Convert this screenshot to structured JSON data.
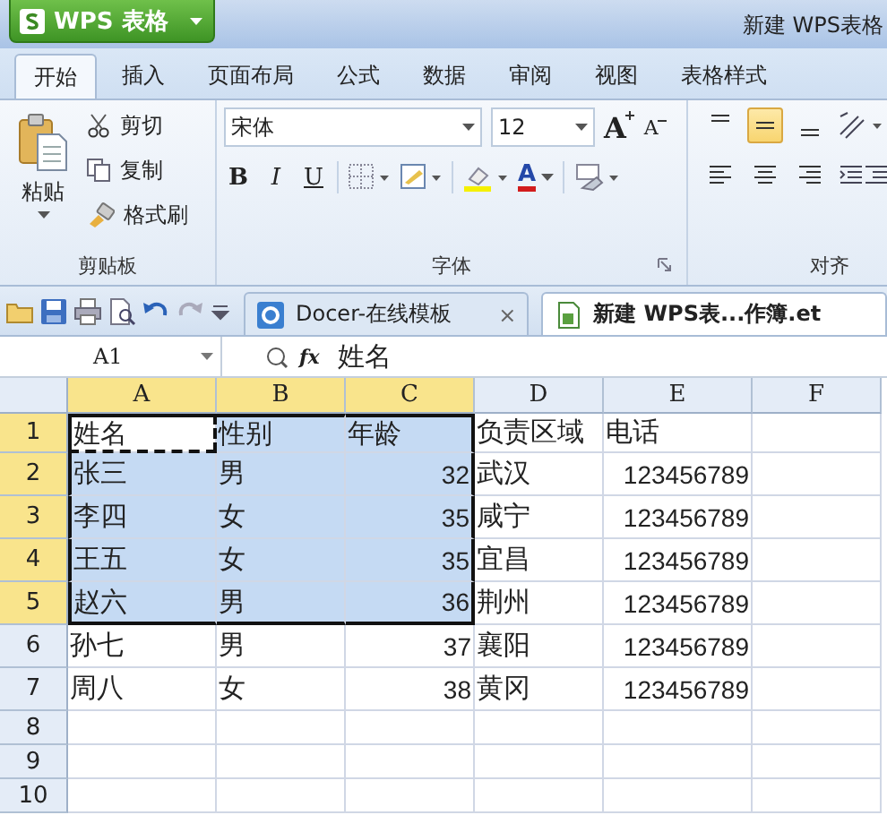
{
  "app_button": {
    "label": "WPS 表格"
  },
  "window": {
    "title": "新建 WPS表格"
  },
  "ribbon_tabs": [
    {
      "label": "开始",
      "selected": true
    },
    {
      "label": "插入",
      "selected": false
    },
    {
      "label": "页面布局",
      "selected": false
    },
    {
      "label": "公式",
      "selected": false
    },
    {
      "label": "数据",
      "selected": false
    },
    {
      "label": "审阅",
      "selected": false
    },
    {
      "label": "视图",
      "selected": false
    },
    {
      "label": "表格样式",
      "selected": false
    }
  ],
  "clipboard": {
    "paste": "粘贴",
    "cut": "剪切",
    "copy": "复制",
    "format_painter": "格式刷",
    "label": "剪贴板"
  },
  "font": {
    "name": "宋体",
    "size": "12",
    "grow": "A",
    "shrink": "A",
    "bold": "B",
    "italic": "I",
    "underline": "U",
    "font_color": "A",
    "label": "字体"
  },
  "alignment": {
    "label": "对齐",
    "vertical": [
      {
        "kind": "top",
        "selected": false
      },
      {
        "kind": "middle",
        "selected": true
      },
      {
        "kind": "bottom",
        "selected": false
      }
    ],
    "horizontal": [
      {
        "kind": "left",
        "selected": false
      },
      {
        "kind": "center",
        "selected": false
      },
      {
        "kind": "right",
        "selected": false
      }
    ]
  },
  "doc_tabs": [
    {
      "label": "Docer-在线模板",
      "selected": false,
      "close": "×"
    },
    {
      "label": "新建 WPS表...作簿.et",
      "selected": true
    }
  ],
  "name_box": "A1",
  "fx": "fx",
  "formula": "姓名",
  "columns": [
    {
      "label": "A",
      "selected": true
    },
    {
      "label": "B",
      "selected": true
    },
    {
      "label": "C",
      "selected": true
    },
    {
      "label": "D",
      "selected": false
    },
    {
      "label": "E",
      "selected": false
    },
    {
      "label": "F",
      "selected": false
    }
  ],
  "rows": [
    {
      "label": "1",
      "selected": true,
      "cells": [
        {
          "text": "姓名",
          "kind": "text",
          "selected": true,
          "marquee": true
        },
        {
          "text": "性别",
          "kind": "text",
          "selected": true
        },
        {
          "text": "年龄",
          "kind": "text",
          "selected": true
        },
        {
          "text": "负责区域",
          "kind": "text",
          "selected": false
        },
        {
          "text": "电话",
          "kind": "text",
          "selected": false
        },
        {
          "text": "",
          "kind": "text",
          "selected": false
        }
      ]
    },
    {
      "label": "2",
      "selected": true,
      "cells": [
        {
          "text": "张三",
          "kind": "text",
          "selected": true
        },
        {
          "text": "男",
          "kind": "text",
          "selected": true
        },
        {
          "text": "32",
          "kind": "number",
          "selected": true
        },
        {
          "text": "武汉",
          "kind": "text",
          "selected": false
        },
        {
          "text": "123456789",
          "kind": "number",
          "selected": false
        },
        {
          "text": "",
          "kind": "text",
          "selected": false
        }
      ]
    },
    {
      "label": "3",
      "selected": true,
      "cells": [
        {
          "text": "李四",
          "kind": "text",
          "selected": true
        },
        {
          "text": "女",
          "kind": "text",
          "selected": true
        },
        {
          "text": "35",
          "kind": "number",
          "selected": true
        },
        {
          "text": "咸宁",
          "kind": "text",
          "selected": false
        },
        {
          "text": "123456789",
          "kind": "number",
          "selected": false
        },
        {
          "text": "",
          "kind": "text",
          "selected": false
        }
      ]
    },
    {
      "label": "4",
      "selected": true,
      "cells": [
        {
          "text": "王五",
          "kind": "text",
          "selected": true
        },
        {
          "text": "女",
          "kind": "text",
          "selected": true
        },
        {
          "text": "35",
          "kind": "number",
          "selected": true
        },
        {
          "text": "宜昌",
          "kind": "text",
          "selected": false
        },
        {
          "text": "123456789",
          "kind": "number",
          "selected": false
        },
        {
          "text": "",
          "kind": "text",
          "selected": false
        }
      ]
    },
    {
      "label": "5",
      "selected": true,
      "cells": [
        {
          "text": "赵六",
          "kind": "text",
          "selected": true
        },
        {
          "text": "男",
          "kind": "text",
          "selected": true
        },
        {
          "text": "36",
          "kind": "number",
          "selected": true
        },
        {
          "text": "荆州",
          "kind": "text",
          "selected": false
        },
        {
          "text": "123456789",
          "kind": "number",
          "selected": false
        },
        {
          "text": "",
          "kind": "text",
          "selected": false
        }
      ]
    },
    {
      "label": "6",
      "selected": false,
      "cells": [
        {
          "text": "孙七",
          "kind": "text",
          "selected": false
        },
        {
          "text": "男",
          "kind": "text",
          "selected": false
        },
        {
          "text": "37",
          "kind": "number",
          "selected": false
        },
        {
          "text": "襄阳",
          "kind": "text",
          "selected": false
        },
        {
          "text": "123456789",
          "kind": "number",
          "selected": false
        },
        {
          "text": "",
          "kind": "text",
          "selected": false
        }
      ]
    },
    {
      "label": "7",
      "selected": false,
      "cells": [
        {
          "text": "周八",
          "kind": "text",
          "selected": false
        },
        {
          "text": "女",
          "kind": "text",
          "selected": false
        },
        {
          "text": "38",
          "kind": "number",
          "selected": false
        },
        {
          "text": "黄冈",
          "kind": "text",
          "selected": false
        },
        {
          "text": "123456789",
          "kind": "number",
          "selected": false
        },
        {
          "text": "",
          "kind": "text",
          "selected": false
        }
      ]
    },
    {
      "label": "8",
      "selected": false,
      "cells": []
    },
    {
      "label": "9",
      "selected": false,
      "cells": []
    },
    {
      "label": "10",
      "selected": false,
      "cells": []
    }
  ]
}
